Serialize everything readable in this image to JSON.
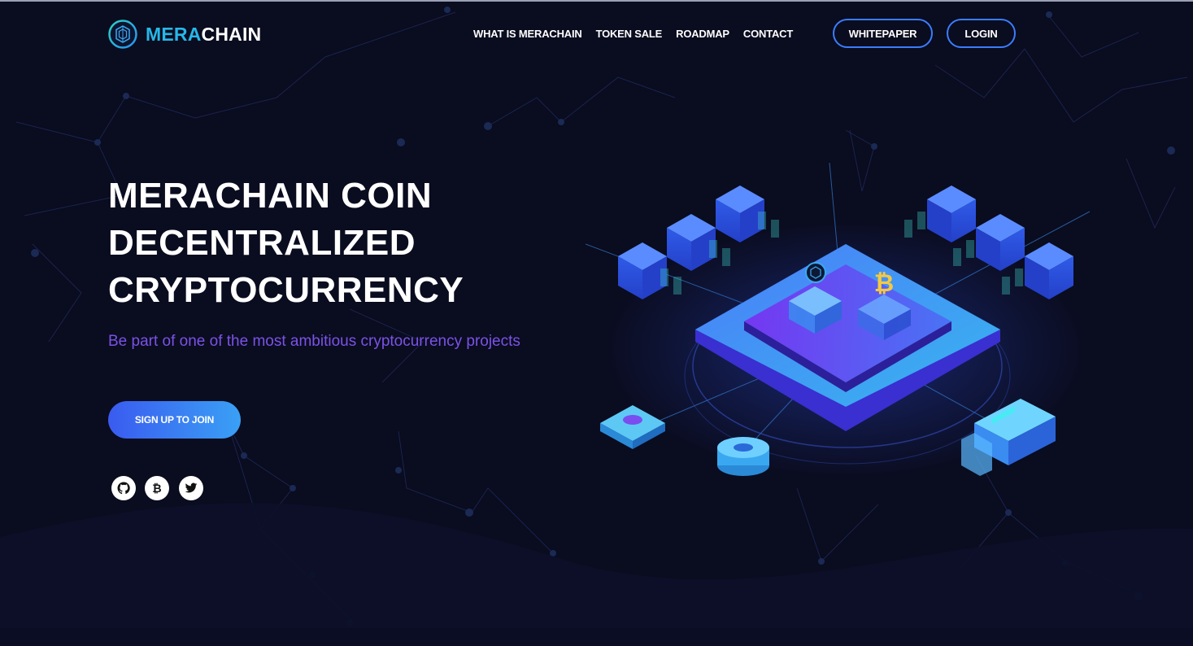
{
  "brand": {
    "part1": "MERA",
    "part2": "CHAIN"
  },
  "nav": {
    "items": [
      {
        "label": "WHAT IS MERACHAIN"
      },
      {
        "label": "TOKEN SALE"
      },
      {
        "label": "ROADMAP"
      },
      {
        "label": "CONTACT"
      }
    ]
  },
  "header_buttons": {
    "whitepaper": "WHITEPAPER",
    "login": "LOGIN"
  },
  "hero": {
    "title_lines": [
      "MERACHAIN COIN",
      "DECENTRALIZED",
      "CRYPTOCURRENCY"
    ],
    "subtitle": "Be part of one of the most ambitious cryptocurrency projects",
    "cta": "SIGN UP TO JOIN"
  },
  "social": [
    {
      "icon": "github-icon"
    },
    {
      "icon": "bitcoin-icon"
    },
    {
      "icon": "twitter-icon"
    }
  ],
  "colors": {
    "background": "#0a0c1f",
    "accent_blue": "#3a7dff",
    "subtitle_purple": "#7b52e8",
    "logo_cyan": "#27b7e8",
    "bitcoin_gold": "#f5c842"
  }
}
